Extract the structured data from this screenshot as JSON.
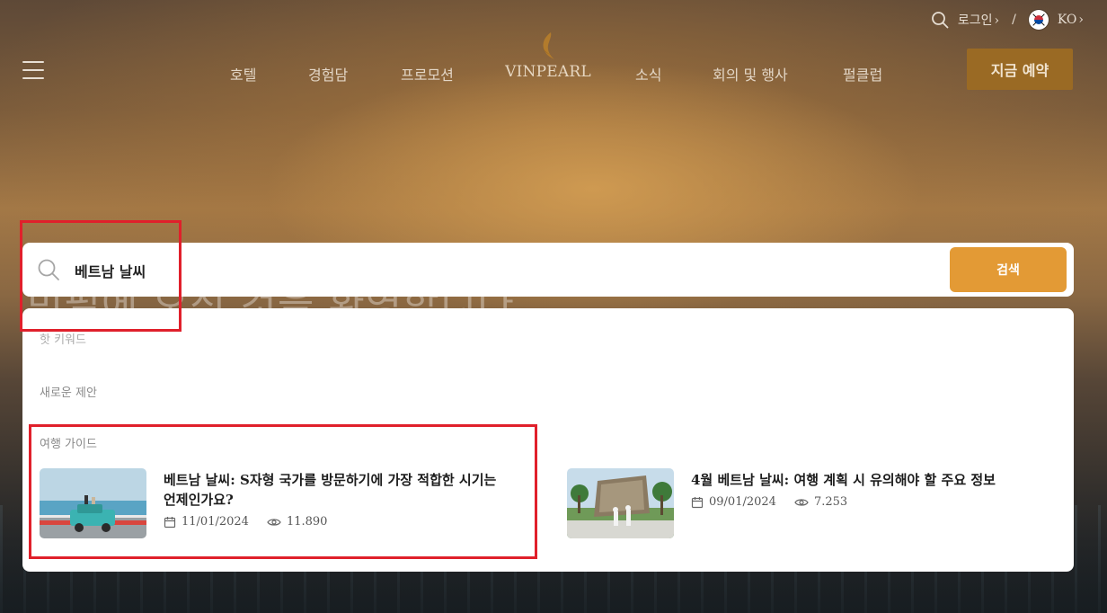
{
  "header": {
    "login_label": "로그인",
    "separator": "/",
    "language_code": "KO",
    "logo_text": "VINPEARL",
    "book_button": "지금 예약",
    "nav": {
      "hotels": "호텔",
      "experiences": "경험담",
      "promotions": "프로모션",
      "news": "소식",
      "meetings": "회의 및 행사",
      "pearl_club": "펄클럽"
    }
  },
  "hero": {
    "faded_title": "빈펄에 오신 것을 환영합니다"
  },
  "search": {
    "query": "베트남 날씨",
    "button_label": "검색"
  },
  "suggestions": {
    "hot_keywords_label": "핫 키워드",
    "new_suggestions_label": "새로운 제안",
    "travel_guide_label": "여행 가이드",
    "guides": [
      {
        "title_line1": "베트남 날씨: S자형 국가를 방문하기에 가장 적합한 시기는",
        "title_line2": "언제인가요?",
        "date": "11/01/2024",
        "views": "11.890"
      },
      {
        "title_line1": "4월 베트남 날씨: 여행 계획 시 유의해야 할 주요 정보",
        "date": "09/01/2024",
        "views": "7.253"
      }
    ]
  },
  "colors": {
    "accent": "#e39a35",
    "book_button": "#9a6a24",
    "annotation": "#e0202b"
  }
}
